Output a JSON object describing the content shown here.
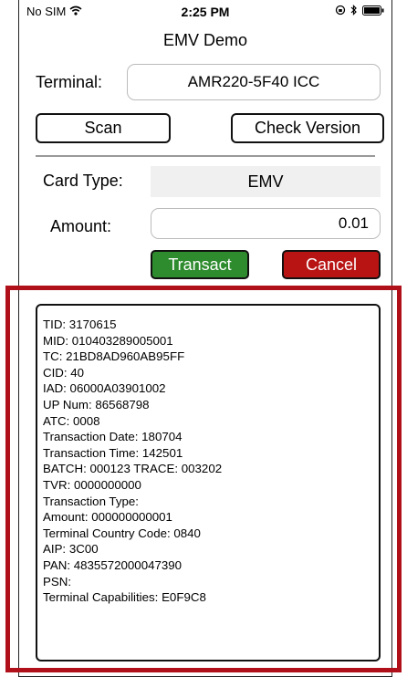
{
  "status_bar": {
    "carrier": "No SIM",
    "time": "2:25 PM"
  },
  "nav": {
    "title": "EMV Demo"
  },
  "terminal": {
    "label": "Terminal:",
    "value": "AMR220-5F40 ICC"
  },
  "buttons": {
    "scan": "Scan",
    "check_version": "Check Version",
    "transact": "Transact",
    "cancel": "Cancel"
  },
  "card_type": {
    "label": "Card Type:",
    "value": "EMV"
  },
  "amount": {
    "label": "Amount:",
    "value": "0.01"
  },
  "log_lines": [
    "TID: 3170615",
    "MID: 010403289005001",
    "TC: 21BD8AD960AB95FF",
    "CID: 40",
    "IAD: 06000A03901002",
    "UP Num: 86568798",
    "ATC: 0008",
    "Transaction Date: 180704",
    "Transaction Time: 142501",
    "BATCH: 000123   TRACE: 003202",
    "TVR: 0000000000",
    "Transaction Type:",
    "Amount: 000000000001",
    "Terminal Country Code: 0840",
    "AIP: 3C00",
    "PAN: 4835572000047390",
    "PSN:",
    "Terminal Capabilities: E0F9C8"
  ],
  "icons": {
    "wifi": "wifi-icon",
    "lock": "rotation-lock-icon",
    "bluetooth": "bluetooth-icon",
    "battery": "battery-icon"
  },
  "colors": {
    "transact": "#2e8b2e",
    "cancel": "#b81414",
    "highlight": "#b0101a"
  }
}
